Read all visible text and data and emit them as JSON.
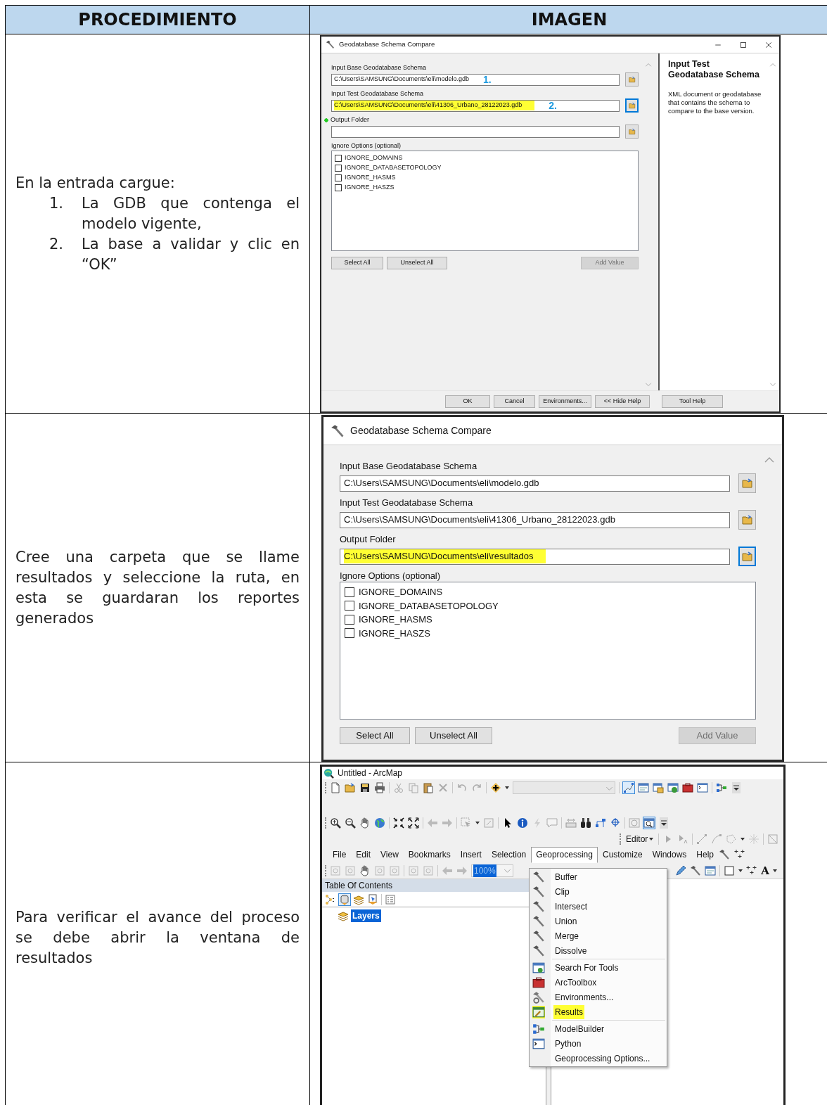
{
  "table": {
    "columns": [
      "PROCEDIMIENTO",
      "IMAGEN"
    ]
  },
  "steps": [
    {
      "intro": "En la entrada cargue:",
      "items": [
        {
          "number": "1.",
          "text": "La GDB que contenga el modelo vigente,"
        },
        {
          "number": "2.",
          "text": "La base a validar y clic en “OK”"
        }
      ],
      "dialog": {
        "title": "Geodatabase Schema Compare",
        "fields": [
          {
            "label": "Input Base Geodatabase Schema",
            "value": "C:\\Users\\SAMSUNG\\Documents\\eli\\modelo.gdb",
            "annotation": "1.",
            "highlighted": false,
            "focused": false,
            "required": false
          },
          {
            "label": "Input Test Geodatabase Schema",
            "value": "C:\\Users\\SAMSUNG\\Documents\\eli\\41306_Urbano_28122023.gdb",
            "annotation": "2.",
            "highlighted": true,
            "focused": true,
            "required": false
          },
          {
            "label": "Output Folder",
            "focused": false,
            "required": true
          }
        ],
        "options_label": "Ignore Options (optional)",
        "options": [
          {
            "label": "IGNORE_DOMAINS",
            "checked": false
          },
          {
            "label": "IGNORE_DATABASETOPOLOGY",
            "checked": false
          },
          {
            "label": "IGNORE_HASMS",
            "checked": false
          },
          {
            "label": "IGNORE_HASZS",
            "checked": false
          }
        ],
        "list_buttons": [
          {
            "label": "Select All",
            "disabled": false
          },
          {
            "label": "Unselect All",
            "disabled": false
          },
          {
            "label": "Add Value",
            "disabled": true
          }
        ],
        "footer_buttons": [
          "OK",
          "Cancel",
          "Environments...",
          "<< Hide Help",
          "Tool Help"
        ],
        "help": {
          "title": "Input Test Geodatabase Schema",
          "text": "XML document or geodatabase that contains the schema to compare to the base version."
        }
      }
    },
    {
      "intro": "Cree una carpeta que se llame resultados y seleccione la ruta, en esta se guardaran los reportes generados",
      "dialog": {
        "title": "Geodatabase Schema Compare",
        "fields": [
          {
            "label": "Input Base Geodatabase Schema",
            "value": "C:\\Users\\SAMSUNG\\Documents\\eli\\modelo.gdb",
            "highlighted": false,
            "focused": false
          },
          {
            "label": "Input Test Geodatabase Schema",
            "value": "C:\\Users\\SAMSUNG\\Documents\\eli\\41306_Urbano_28122023.gdb",
            "highlighted": false,
            "focused": false
          },
          {
            "label": "Output Folder",
            "value": "C:\\Users\\SAMSUNG\\Documents\\eli\\resultados",
            "highlighted": true,
            "focused": true
          }
        ],
        "options_label": "Ignore Options (optional)",
        "options": [
          {
            "label": "IGNORE_DOMAINS",
            "checked": false
          },
          {
            "label": "IGNORE_DATABASETOPOLOGY",
            "checked": false
          },
          {
            "label": "IGNORE_HASMS",
            "checked": false
          },
          {
            "label": "IGNORE_HASZS",
            "checked": false
          }
        ],
        "list_buttons": [
          {
            "label": "Select All",
            "disabled": false
          },
          {
            "label": "Unselect All",
            "disabled": false
          },
          {
            "label": "Add Value",
            "disabled": true
          }
        ]
      }
    },
    {
      "intro": "Para verificar el avance del proceso se debe abrir la ventana de resultados",
      "arcmap": {
        "title": "Untitled - ArcMap",
        "editor_label": "Editor",
        "zoom_value": "100%",
        "text_tool": "A",
        "menus": [
          {
            "label": "File",
            "selected": false
          },
          {
            "label": "Edit",
            "selected": false
          },
          {
            "label": "View",
            "selected": false
          },
          {
            "label": "Bookmarks",
            "selected": false
          },
          {
            "label": "Insert",
            "selected": false
          },
          {
            "label": "Selection",
            "selected": false
          },
          {
            "label": "Geoprocessing",
            "selected": true
          },
          {
            "label": "Customize",
            "selected": false
          },
          {
            "label": "Windows",
            "selected": false
          },
          {
            "label": "Help",
            "selected": false
          }
        ],
        "dropdown": [
          [
            {
              "label": "Buffer",
              "highlighted": false
            },
            {
              "label": "Clip",
              "highlighted": false
            },
            {
              "label": "Intersect",
              "highlighted": false
            },
            {
              "label": "Union",
              "highlighted": false
            },
            {
              "label": "Merge",
              "highlighted": false
            },
            {
              "label": "Dissolve",
              "highlighted": false
            }
          ],
          [
            {
              "label": "Search For Tools",
              "highlighted": false
            },
            {
              "label": "ArcToolbox",
              "highlighted": false
            },
            {
              "label": "Environments...",
              "highlighted": false
            },
            {
              "label": "Results",
              "highlighted": true
            }
          ],
          [
            {
              "label": "ModelBuilder",
              "highlighted": false
            },
            {
              "label": "Python",
              "highlighted": false
            },
            {
              "label": "Geoprocessing Options...",
              "highlighted": false
            }
          ]
        ],
        "toc": {
          "title": "Table Of Contents",
          "layers": [
            {
              "label": "Layers",
              "selected": true
            }
          ]
        }
      }
    }
  ]
}
